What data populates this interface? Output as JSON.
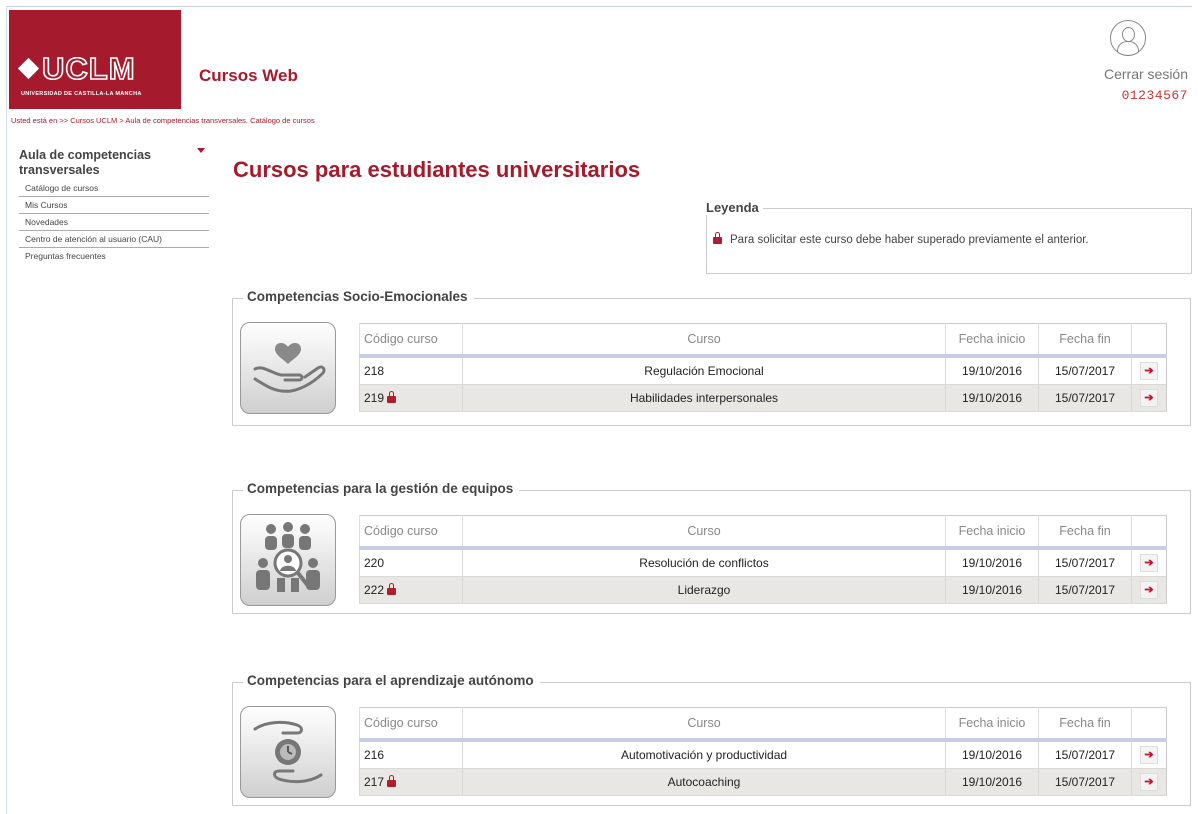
{
  "header": {
    "logo_text": "UCLM",
    "logo_subtext": "UNIVERSIDAD DE CASTILLA-LA MANCHA",
    "app_title": "Cursos Web",
    "breadcrumb": "Usted está en >> Cursos UCLM > Aula de competencias transversales. Catálogo de cursos",
    "logout_label": "Cerrar sesión",
    "user_id": "01234567"
  },
  "sidebar": {
    "title": "Aula de competencias transversales",
    "items": [
      {
        "label": "Catálogo de cursos"
      },
      {
        "label": "Mis Cursos"
      },
      {
        "label": "Novedades"
      },
      {
        "label": "Centro de atención al usuario (CAU)"
      },
      {
        "label": "Preguntas frecuentes"
      }
    ]
  },
  "main": {
    "title": "Cursos para estudiantes universitarios",
    "legend": {
      "title": "Leyenda",
      "text": "Para solicitar este curso debe haber superado previamente el anterior."
    },
    "table_headers": {
      "code": "Código curso",
      "course": "Curso",
      "start": "Fecha inicio",
      "end": "Fecha fin"
    },
    "sections": [
      {
        "title": "Competencias Socio-Emocionales",
        "icon": "heart-in-hand-icon",
        "rows": [
          {
            "code": "218",
            "locked": false,
            "name": "Regulación Emocional",
            "start": "19/10/2016",
            "end": "15/07/2017"
          },
          {
            "code": "219",
            "locked": true,
            "name": "Habilidades interpersonales",
            "start": "19/10/2016",
            "end": "15/07/2017"
          }
        ]
      },
      {
        "title": "Competencias para la gestión de equipos",
        "icon": "team-search-icon",
        "rows": [
          {
            "code": "220",
            "locked": false,
            "name": "Resolución de conflictos",
            "start": "19/10/2016",
            "end": "15/07/2017"
          },
          {
            "code": "222",
            "locked": true,
            "name": "Liderazgo",
            "start": "19/10/2016",
            "end": "15/07/2017"
          }
        ]
      },
      {
        "title": "Competencias para el aprendizaje autónomo",
        "icon": "clock-in-hands-icon",
        "rows": [
          {
            "code": "216",
            "locked": false,
            "name": "Automotivación y productividad",
            "start": "19/10/2016",
            "end": "15/07/2017"
          },
          {
            "code": "217",
            "locked": true,
            "name": "Autocoaching",
            "start": "19/10/2016",
            "end": "15/07/2017"
          }
        ]
      }
    ]
  },
  "colors": {
    "brand": "#a51a2c",
    "lock": "#b01e2e",
    "row_alt": "#e8e7e3"
  }
}
